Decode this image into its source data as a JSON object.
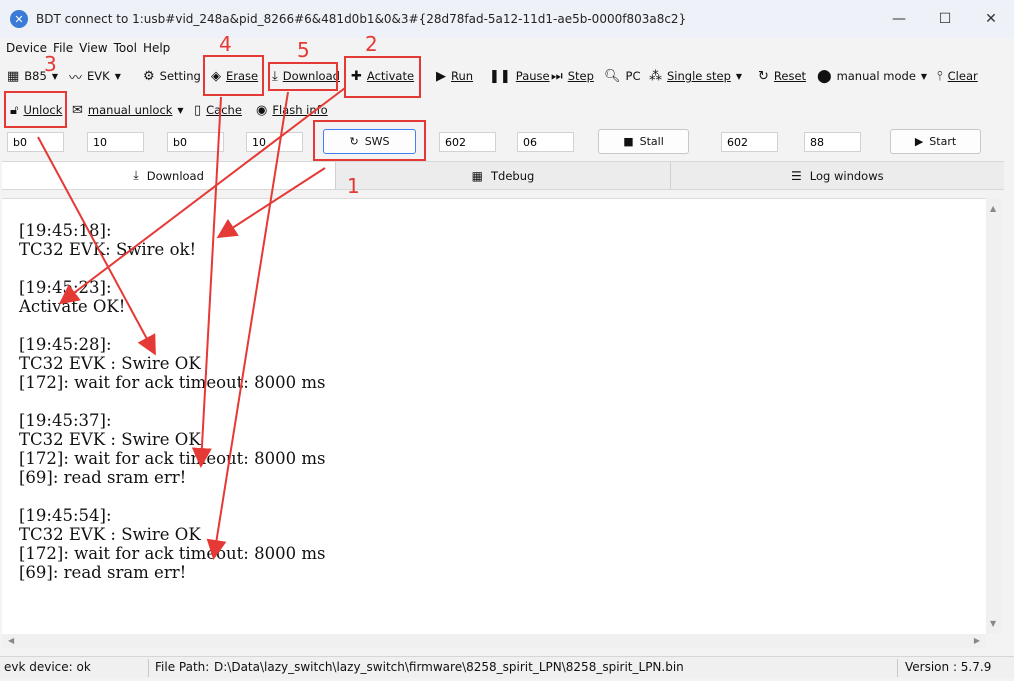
{
  "window": {
    "title": "BDT connect to 1:usb#vid_248a&pid_8266#6&481d0b1&0&3#{28d78fad-5a12-11d1-ae5b-0000f803a8c2}",
    "minimize": "—",
    "maximize": "☐",
    "close": "✕"
  },
  "menu": [
    "Device",
    "File",
    "View",
    "Tool",
    "Help"
  ],
  "toolbar1": {
    "chip": "B85",
    "evk": "EVK",
    "setting": "Setting",
    "erase": "Erase",
    "download": "Download",
    "activate": "Activate",
    "run": "Run",
    "pause": "Pause",
    "step": "Step",
    "pc": "PC",
    "single_step": "Single step",
    "reset": "Reset",
    "manual_mode": "manual mode",
    "clear": "Clear"
  },
  "toolbar2": {
    "unlock": "Unlock",
    "manual_unlock": "manual unlock",
    "cache": "Cache",
    "flash_info": "Flash info"
  },
  "row3": {
    "f1": "b0",
    "f2": "10",
    "f3": "b0",
    "f4": "10",
    "sws": "SWS",
    "f5": "602",
    "f6": "06",
    "stall": "Stall",
    "f7": "602",
    "f8": "88",
    "start": "Start"
  },
  "tabs": {
    "download": "Download",
    "tdebug": "Tdebug",
    "log": "Log windows"
  },
  "log": [
    "[19:45:18]:\nTC32 EVK: Swire ok!",
    "[19:45:23]:\nActivate OK!",
    "[19:45:28]:\nTC32 EVK : Swire OK\n[172]: wait for ack timeout: 8000 ms",
    "[19:45:37]:\nTC32 EVK : Swire OK\n[172]: wait for ack timeout: 8000 ms\n[69]: read sram err!",
    "[19:45:54]:\nTC32 EVK : Swire OK\n[172]: wait for ack timeout: 8000 ms\n[69]: read sram err!"
  ],
  "status": {
    "device": "evk device: ok",
    "file_path_label": "File Path:",
    "file_path": "D:\\Data\\lazy_switch\\lazy_switch\\firmware\\8258_spirit_LPN\\8258_spirit_LPN.bin",
    "version": "Version : 5.7.9"
  },
  "annotations": {
    "n1": "1",
    "n2": "2",
    "n3": "3",
    "n4": "4",
    "n5": "5",
    "color": "#e53935"
  }
}
